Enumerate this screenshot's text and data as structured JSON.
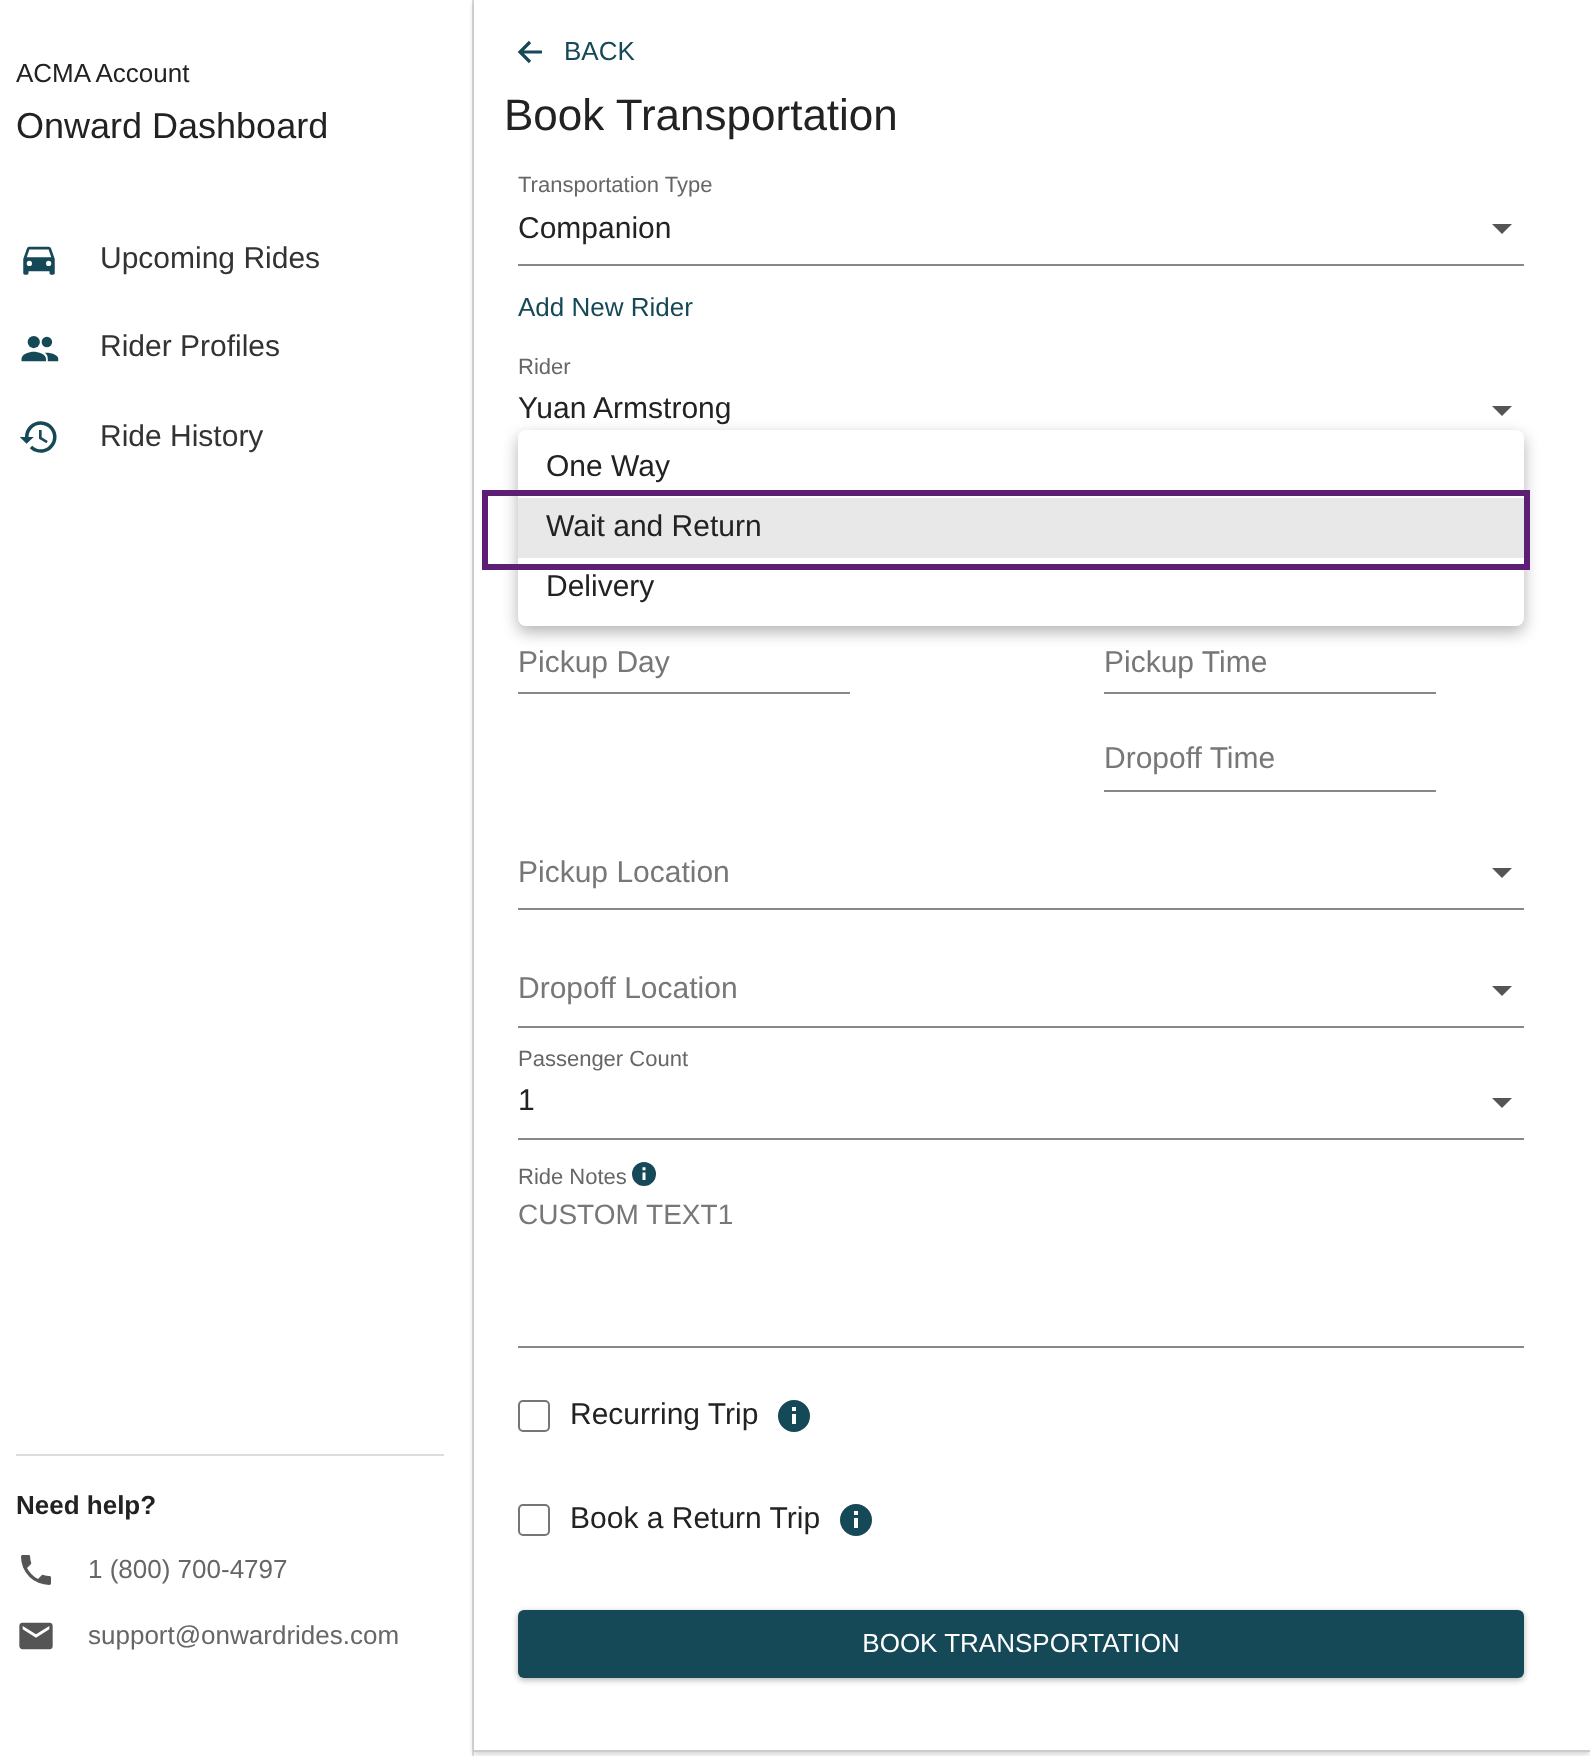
{
  "sidebar": {
    "account": "ACMA Account",
    "title": "Onward Dashboard",
    "items": [
      {
        "label": "Upcoming Rides",
        "kind": "car"
      },
      {
        "label": "Rider Profiles",
        "kind": "people"
      },
      {
        "label": "Ride History",
        "kind": "history"
      }
    ],
    "help": {
      "title": "Need help?",
      "contacts": [
        {
          "kind": "phone",
          "text": "1 (800) 700-4797"
        },
        {
          "kind": "email",
          "text": "support@onwardrides.com"
        }
      ]
    }
  },
  "main": {
    "back": "BACK",
    "title": "Book Transportation",
    "transportation_type": {
      "label": "Transportation Type",
      "value": "Companion"
    },
    "add_rider": "Add New Rider",
    "rider": {
      "label": "Rider",
      "value": "Yuan Armstrong"
    },
    "menu": [
      {
        "label": "One Way",
        "selected": false
      },
      {
        "label": "Wait and Return",
        "selected": true
      },
      {
        "label": "Delivery",
        "selected": false
      }
    ],
    "pickup_day": {
      "placeholder": "Pickup Day"
    },
    "pickup_time": {
      "placeholder": "Pickup Time"
    },
    "dropoff_time": {
      "placeholder": "Dropoff Time"
    },
    "pickup_location": {
      "placeholder": "Pickup Location"
    },
    "dropoff_location": {
      "placeholder": "Dropoff Location"
    },
    "passenger_count": {
      "label": "Passenger Count",
      "value": "1"
    },
    "ride_notes": {
      "label": "Ride Notes",
      "placeholder": "CUSTOM TEXT1"
    },
    "checkboxes": [
      {
        "label": "Recurring Trip",
        "checked": false
      },
      {
        "label": "Book a Return Trip",
        "checked": false
      }
    ],
    "submit": "BOOK TRANSPORTATION"
  }
}
